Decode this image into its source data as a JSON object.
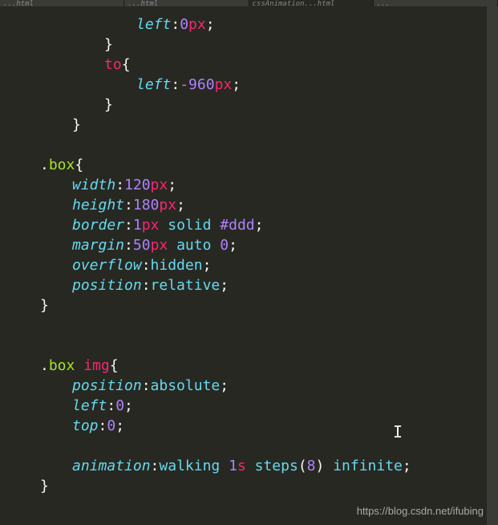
{
  "tabs": {
    "tab1": "...html",
    "tab2": "...html",
    "tab3": "cssAnimation...html",
    "tab4": "..."
  },
  "code": {
    "l1_prop": "left",
    "l1_colon": ":",
    "l1_num": "0",
    "l1_unit": "px",
    "l1_semi": ";",
    "l2_brace": "}",
    "l3_to": "to",
    "l3_brace": "{",
    "l4_prop": "left",
    "l4_colon": ":",
    "l4_num": "-960",
    "l4_unit": "px",
    "l4_semi": ";",
    "l5_brace": "}",
    "l6_brace": "}",
    "l8_dot": ".",
    "l8_sel": "box",
    "l8_brace": "{",
    "l9_prop": "width",
    "l9_colon": ":",
    "l9_num": "120",
    "l9_unit": "px",
    "l9_semi": ";",
    "l10_prop": "height",
    "l10_colon": ":",
    "l10_num": "180",
    "l10_unit": "px",
    "l10_semi": ";",
    "l11_prop": "border",
    "l11_colon": ":",
    "l11_num": "1",
    "l11_unit": "px",
    "l11_sp": " ",
    "l11_val": "solid",
    "l11_sp2": " ",
    "l11_hex": "#ddd",
    "l11_semi": ";",
    "l12_prop": "margin",
    "l12_colon": ":",
    "l12_num": "50",
    "l12_unit": "px",
    "l12_sp": " ",
    "l12_val": "auto",
    "l12_sp2": " ",
    "l12_num2": "0",
    "l12_semi": ";",
    "l13_prop": "overflow",
    "l13_colon": ":",
    "l13_val": "hidden",
    "l13_semi": ";",
    "l14_prop": "position",
    "l14_colon": ":",
    "l14_val": "relative",
    "l14_semi": ";",
    "l15_brace": "}",
    "l17_dot": ".",
    "l17_sel": "box",
    "l17_sp": " ",
    "l17_tag": "img",
    "l17_brace": "{",
    "l18_prop": "position",
    "l18_colon": ":",
    "l18_val": "absolute",
    "l18_semi": ";",
    "l19_prop": "left",
    "l19_colon": ":",
    "l19_num": "0",
    "l19_semi": ";",
    "l20_prop": "top",
    "l20_colon": ":",
    "l20_num": "0",
    "l20_semi": ";",
    "l22_prop": "animation",
    "l22_colon": ":",
    "l22_val": "walking",
    "l22_sp": " ",
    "l22_num": "1",
    "l22_unit": "s",
    "l22_sp2": " ",
    "l22_fn": "steps",
    "l22_paren1": "(",
    "l22_arg": "8",
    "l22_paren2": ")",
    "l22_sp3": " ",
    "l22_val2": "infinite",
    "l22_semi": ";",
    "l23_brace": "}"
  },
  "cursor": "I",
  "watermark": "https://blog.csdn.net/ifubing"
}
